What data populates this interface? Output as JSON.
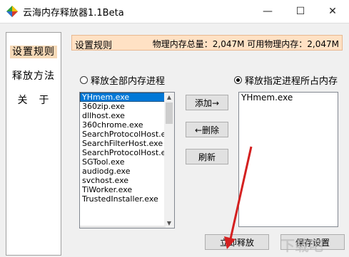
{
  "window": {
    "title": "云海内存释放器1.1Beta",
    "min": "—",
    "max": "☐",
    "close": "✕"
  },
  "nav": {
    "items": [
      "设置规则",
      "释放方法",
      "关　于"
    ]
  },
  "header": {
    "title": "设置规则",
    "memory": "物理内存总量：2,047M 可用物理内存：2,047M"
  },
  "radios": {
    "all": "释放全部内存进程",
    "specific": "释放指定进程所占内存"
  },
  "process_list": [
    "YHmem.exe",
    "360zip.exe",
    "dllhost.exe",
    "360chrome.exe",
    "SearchProtocolHost.exe",
    "SearchFilterHost.exe",
    "SearchProtocolHost.exe",
    "SGTool.exe",
    "audiodg.exe",
    "svchost.exe",
    "TiWorker.exe",
    "TrustedInstaller.exe"
  ],
  "target_list": [
    "YHmem.exe"
  ],
  "buttons": {
    "add": "添加→",
    "remove": "←删除",
    "refresh": "刷新",
    "release_now": "立即释放",
    "save": "保存设置"
  },
  "watermark": "下载吧"
}
